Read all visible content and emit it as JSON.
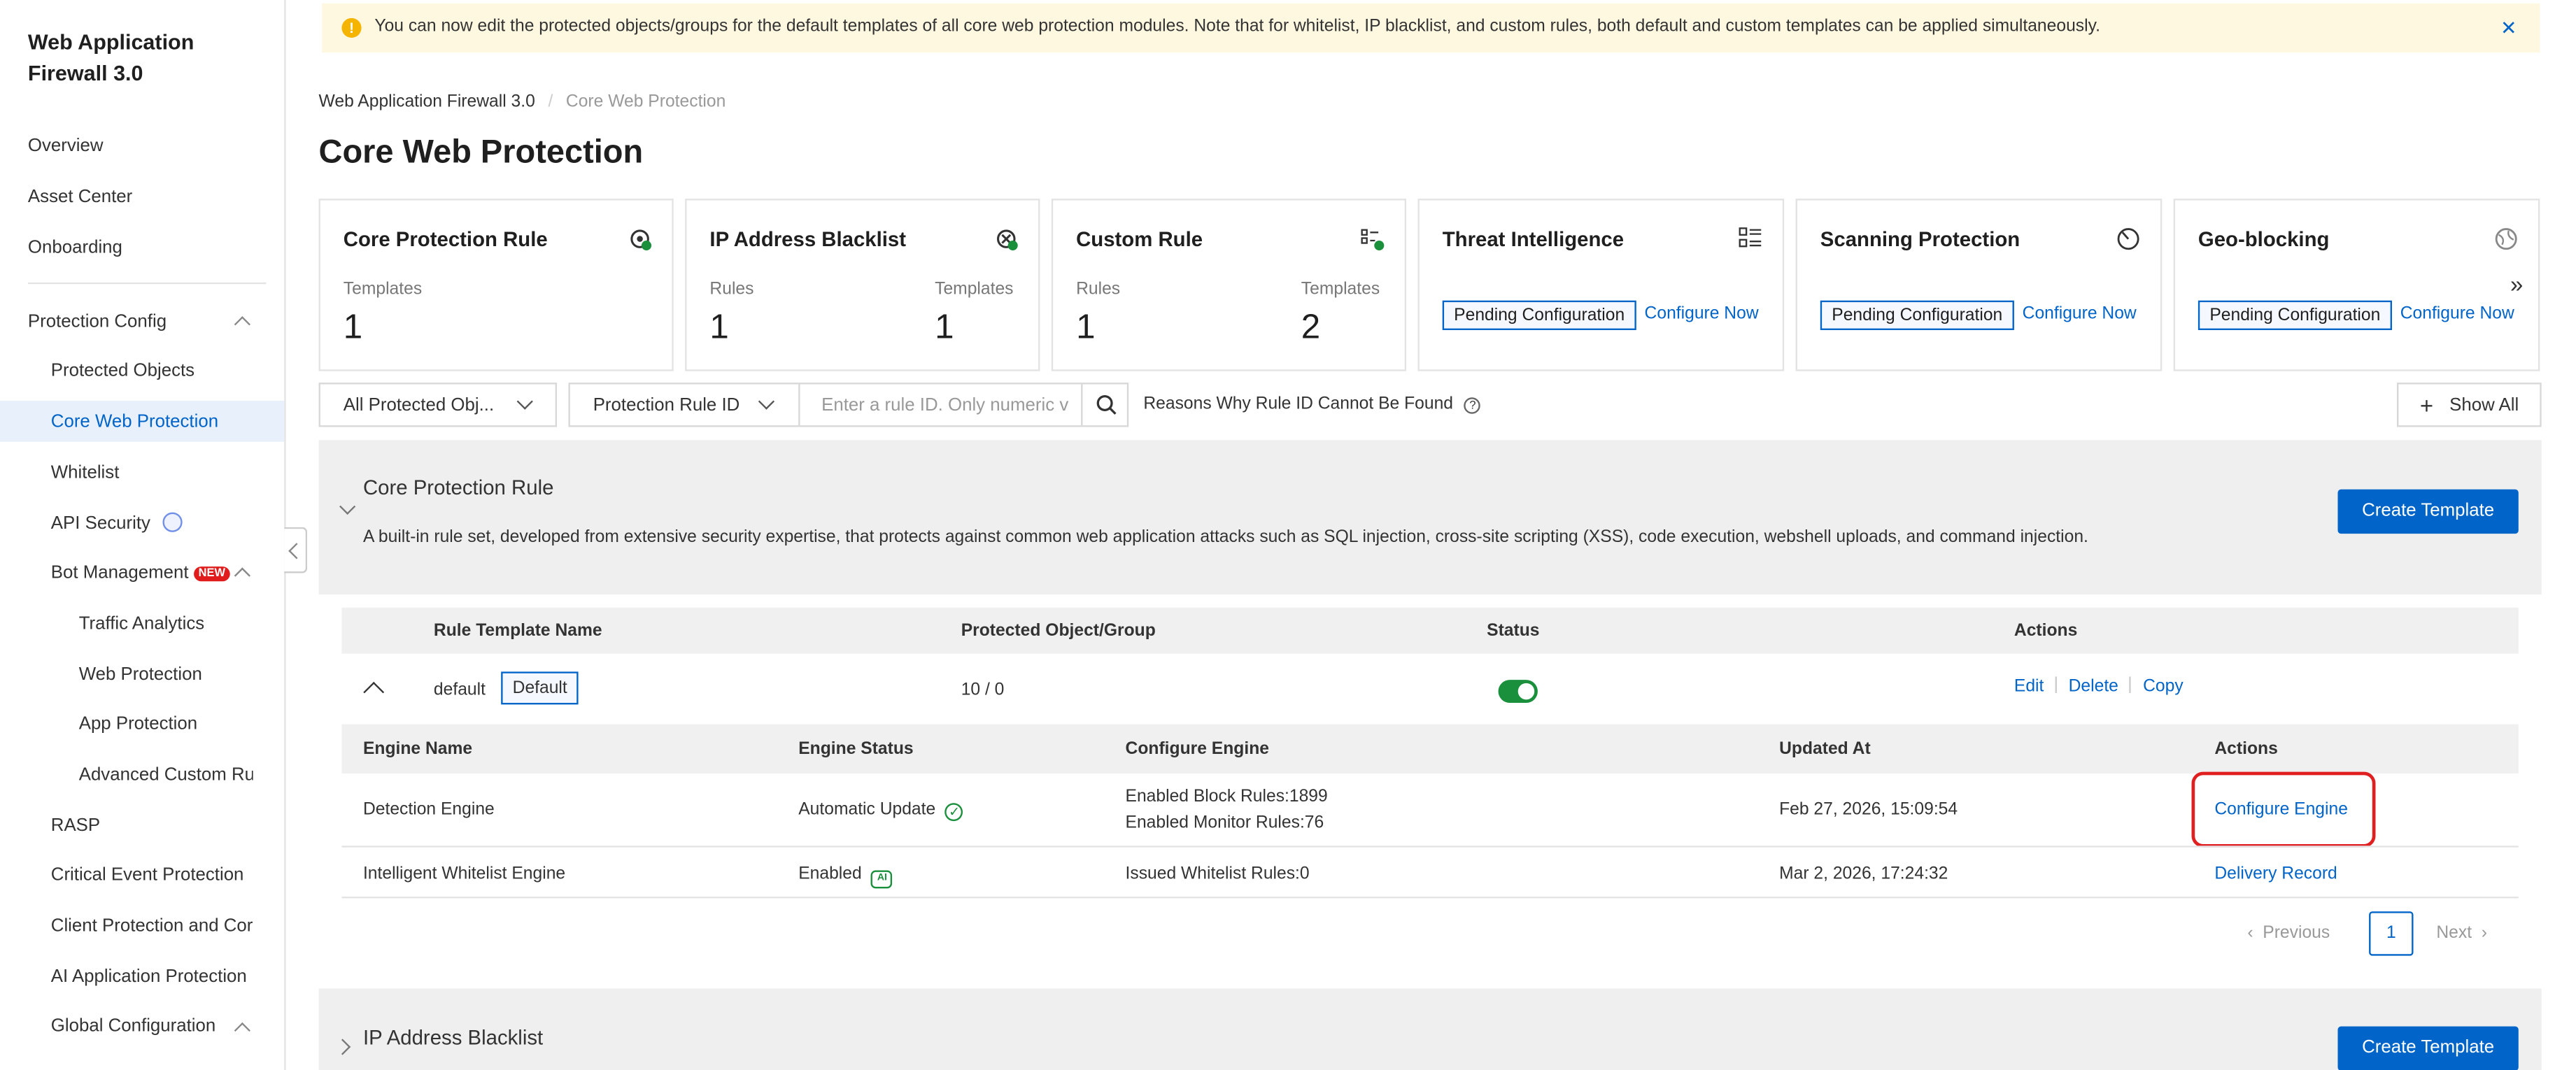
{
  "app": {
    "title": "Web Application Firewall 3.0"
  },
  "sidebar": {
    "items": [
      {
        "label": "Overview"
      },
      {
        "label": "Asset Center"
      },
      {
        "label": "Onboarding"
      },
      {
        "label": "Protection Config"
      },
      {
        "label": "Protected Objects"
      },
      {
        "label": "Core Web Protection",
        "active": true
      },
      {
        "label": "Whitelist"
      },
      {
        "label": "API Security"
      },
      {
        "label": "Bot Management",
        "badge": "NEW"
      },
      {
        "label": "Traffic Analytics"
      },
      {
        "label": "Web Protection"
      },
      {
        "label": "App Protection"
      },
      {
        "label": "Advanced Custom Rul"
      },
      {
        "label": "RASP"
      },
      {
        "label": "Critical Event Protection"
      },
      {
        "label": "Client Protection and Cor"
      },
      {
        "label": "AI Application Protection"
      },
      {
        "label": "Global Configuration"
      }
    ]
  },
  "banner": {
    "text": "You can now edit the protected objects/groups for the default templates of all core web protection modules. Note that for whitelist, IP blacklist, and custom rules, both default and custom templates can be applied simultaneously."
  },
  "breadcrumb": {
    "root": "Web Application Firewall 3.0",
    "sep": "/",
    "current": "Core Web Protection"
  },
  "page_title": "Core Web Protection",
  "cards": [
    {
      "title": "Core Protection Rule",
      "icon": "shield-check-icon",
      "left_label": "Templates",
      "left_value": "1"
    },
    {
      "title": "IP Address Blacklist",
      "icon": "blocked-ip-icon",
      "left_label": "Rules",
      "left_value": "1",
      "right_label": "Templates",
      "right_value": "1"
    },
    {
      "title": "Custom Rule",
      "icon": "rule-list-icon",
      "left_label": "Rules",
      "left_value": "1",
      "right_label": "Templates",
      "right_value": "2"
    },
    {
      "title": "Threat Intelligence",
      "icon": "intel-grid-icon",
      "pending": "Pending Configuration",
      "action": "Configure Now"
    },
    {
      "title": "Scanning Protection",
      "icon": "scan-icon",
      "pending": "Pending Configuration",
      "action": "Configure Now"
    },
    {
      "title": "Geo-blocking",
      "icon": "globe-icon",
      "pending": "Pending Configuration",
      "action": "Configure Now"
    }
  ],
  "filters": {
    "object_select": "All Protected Obj...",
    "rule_field": "Protection Rule ID",
    "search_placeholder": "Enter a rule ID. Only numeric v",
    "reason_link": "Reasons Why Rule ID Cannot Be Found",
    "show_all": "Show All"
  },
  "core_section": {
    "title": "Core Protection Rule",
    "description": "A built-in rule set, developed from extensive security expertise, that protects against common web application attacks such as SQL injection, cross-site scripting (XSS), code execution, webshell uploads, and command injection.",
    "create_button": "Create Template",
    "table_headers": [
      "Rule Template Name",
      "Protected Object/Group",
      "Status",
      "Actions"
    ],
    "row": {
      "name": "default",
      "tag": "Default",
      "protected": "10 / 0",
      "status_on": true,
      "actions": [
        "Edit",
        "Delete",
        "Copy"
      ]
    },
    "engine_headers": [
      "Engine Name",
      "Engine Status",
      "Configure Engine",
      "Updated At",
      "Actions"
    ],
    "engines": [
      {
        "name": "Detection Engine",
        "status": "Automatic Update",
        "config_line1": "Enabled Block Rules:1899",
        "config_line2": "Enabled Monitor Rules:76",
        "updated": "Feb 27, 2026, 15:09:54",
        "action": "Configure Engine"
      },
      {
        "name": "Intelligent Whitelist Engine",
        "status": "Enabled",
        "config_line1": "Issued Whitelist Rules:0",
        "updated": "Mar 2, 2026, 17:24:32",
        "action": "Delivery Record"
      }
    ],
    "pagination": {
      "prev": "Previous",
      "page": "1",
      "next": "Next"
    }
  },
  "blacklist_section": {
    "title": "IP Address Blacklist",
    "create_button": "Create Template"
  },
  "colors": {
    "accent": "#0064c8",
    "toggle_on": "#1a8f3c",
    "highlight": "#e02020",
    "banner_bg": "#fff8e1"
  }
}
